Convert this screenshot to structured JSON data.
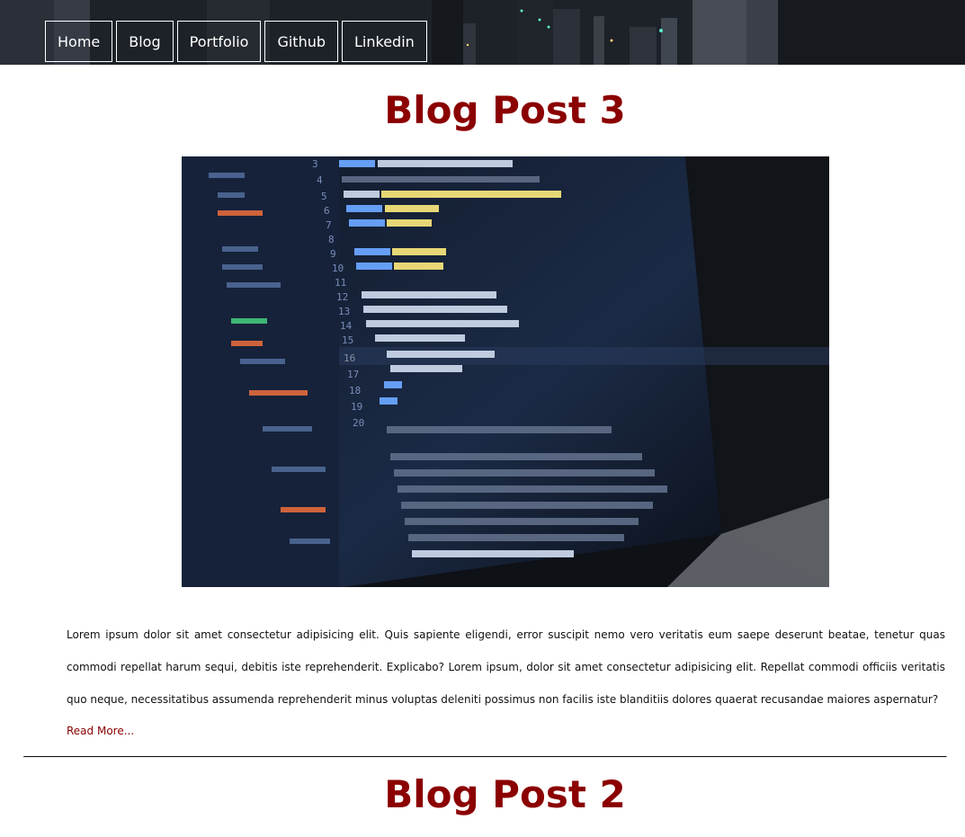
{
  "nav": {
    "items": [
      {
        "label": "Home"
      },
      {
        "label": "Blog"
      },
      {
        "label": "Portfolio"
      },
      {
        "label": "Github"
      },
      {
        "label": "Linkedin"
      }
    ]
  },
  "posts": [
    {
      "title": "Blog Post 3",
      "image": "laptop-code-screen",
      "body": "Lorem ipsum dolor sit amet consectetur adipisicing elit. Quis sapiente eligendi, error suscipit nemo vero veritatis eum saepe deserunt beatae, tenetur quas commodi repellat harum sequi, debitis iste reprehenderit. Explicabo? Lorem ipsum, dolor sit amet consectetur adipisicing elit. Repellat commodi officiis veritatis quo neque, necessitatibus assumenda reprehenderit minus voluptas deleniti possimus non facilis iste blanditiis dolores quaerat recusandae maiores aspernatur?",
      "read_more": "Read More..."
    },
    {
      "title": "Blog Post 2"
    }
  ],
  "colors": {
    "accent": "#8b0000",
    "nav_text": "#ffffff",
    "header_bg": "#1b1e24"
  }
}
